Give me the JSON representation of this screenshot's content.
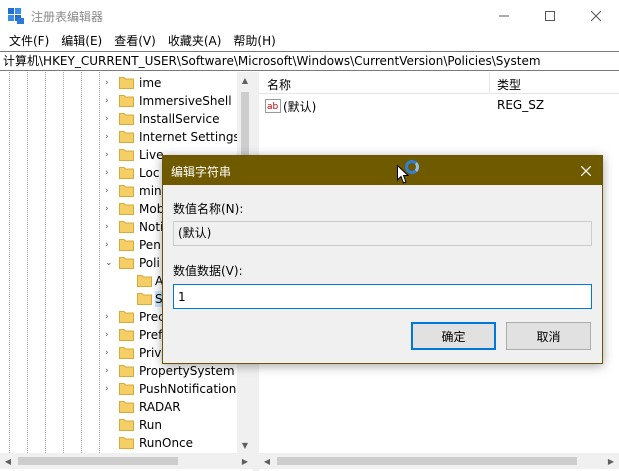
{
  "window": {
    "title": "注册表编辑器",
    "icon": "regedit-icon",
    "controls": [
      "minimize-icon",
      "maximize-icon",
      "close-icon"
    ]
  },
  "menu": [
    {
      "label": "文件(F)"
    },
    {
      "label": "编辑(E)"
    },
    {
      "label": "查看(V)"
    },
    {
      "label": "收藏夹(A)"
    },
    {
      "label": "帮助(H)"
    }
  ],
  "address": {
    "path": "计算机\\HKEY_CURRENT_USER\\Software\\Microsoft\\Windows\\CurrentVersion\\Policies\\System"
  },
  "tree": {
    "items": [
      {
        "label": "ime",
        "expander": "›"
      },
      {
        "label": "ImmersiveShell",
        "expander": "›"
      },
      {
        "label": "InstallService",
        "expander": "›"
      },
      {
        "label": "Internet Settings",
        "expander": "›"
      },
      {
        "label": "Live",
        "expander": "›"
      },
      {
        "label": "Loc",
        "expander": "›"
      },
      {
        "label": "min",
        "expander": "›"
      },
      {
        "label": "Mob",
        "expander": "›"
      },
      {
        "label": "Noti",
        "expander": "›"
      },
      {
        "label": "Pen",
        "expander": "›"
      },
      {
        "label": "Poli",
        "expander": "⌄"
      },
      {
        "label": "A",
        "expander": ""
      },
      {
        "label": "S",
        "expander": ""
      },
      {
        "label": "Prec",
        "expander": "›"
      },
      {
        "label": "Pref",
        "expander": "›"
      },
      {
        "label": "Priv",
        "expander": "›"
      },
      {
        "label": "PropertySystem",
        "expander": "›"
      },
      {
        "label": "PushNotifications",
        "expander": "›"
      },
      {
        "label": "RADAR",
        "expander": ""
      },
      {
        "label": "Run",
        "expander": ""
      },
      {
        "label": "RunOnce",
        "expander": ""
      }
    ]
  },
  "list": {
    "columns": [
      "名称",
      "类型"
    ],
    "rows": [
      {
        "name": "(默认)",
        "type": "REG_SZ",
        "icon": "string-value-icon"
      }
    ]
  },
  "dialog": {
    "title": "编辑字符串",
    "name_label": "数值名称(N):",
    "name_value": "(默认)",
    "data_label": "数值数据(V):",
    "data_value": "1",
    "ok_label": "确定",
    "cancel_label": "取消"
  },
  "colors": {
    "dialog_titlebar": "#6f5a00",
    "accent": "#0078d7",
    "folder": "#f5cf66"
  }
}
